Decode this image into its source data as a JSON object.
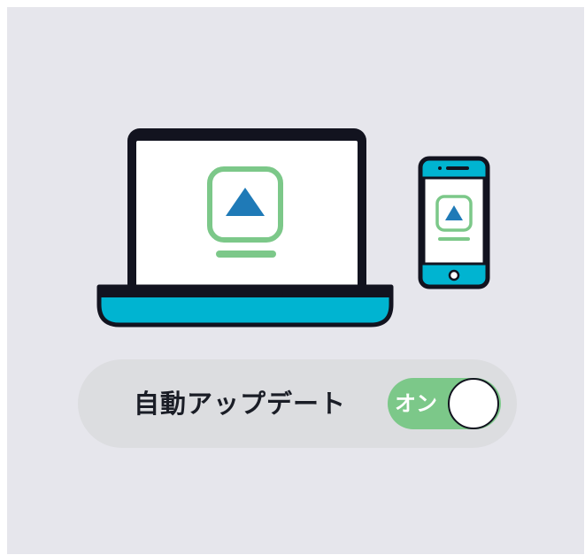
{
  "auto_update": {
    "label": "自動アップデート",
    "toggle_state": "オン",
    "enabled": true
  },
  "devices": {
    "laptop_screen_icon": "app-upload-icon",
    "phone_screen_icon": "app-upload-icon"
  },
  "colors": {
    "background": "#e6e6ec",
    "outline": "#12131f",
    "device_accent": "#00b4d1",
    "app_icon_frame": "#7cc889",
    "arrow": "#1f7ab7",
    "toggle_on": "#7cc889",
    "row_background": "#dcdde0"
  }
}
